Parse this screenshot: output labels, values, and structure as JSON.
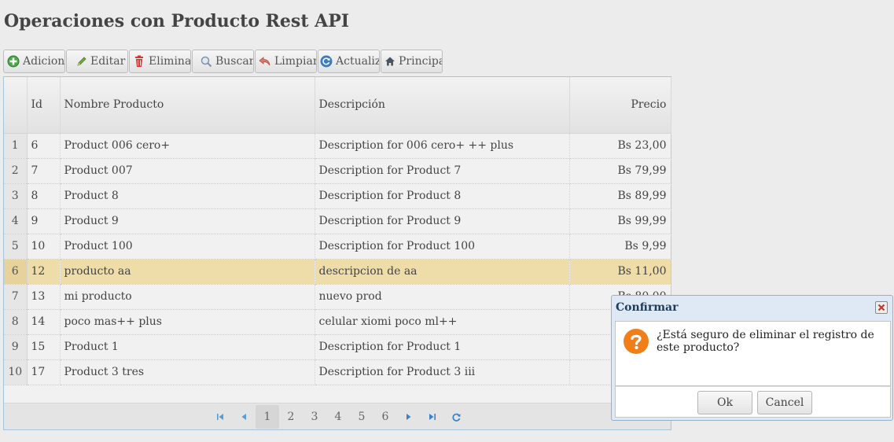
{
  "title": "Operaciones con Producto Rest API",
  "toolbar": {
    "buttons": [
      {
        "label": "Adicionar",
        "icon": "add-icon"
      },
      {
        "label": "Editar",
        "icon": "pencil-icon"
      },
      {
        "label": "Eliminar",
        "icon": "trash-icon"
      },
      {
        "label": "Buscar",
        "icon": "search-icon"
      },
      {
        "label": "Limpiar",
        "icon": "undo-icon"
      },
      {
        "label": "Actualizar",
        "icon": "refresh-icon"
      },
      {
        "label": "Principal",
        "icon": "home-icon"
      }
    ]
  },
  "grid": {
    "columns": {
      "id": "Id",
      "name": "Nombre Producto",
      "desc": "Descripción",
      "price": "Precio"
    },
    "rows": [
      {
        "n": "1",
        "id": "6",
        "name": "Product 006 cero+",
        "desc": "Description for 006 cero+ ++ plus",
        "price": "Bs 23,00"
      },
      {
        "n": "2",
        "id": "7",
        "name": "Product 007",
        "desc": "Description for Product 7",
        "price": "Bs 79,99"
      },
      {
        "n": "3",
        "id": "8",
        "name": "Product 8",
        "desc": "Description for Product 8",
        "price": "Bs 89,99"
      },
      {
        "n": "4",
        "id": "9",
        "name": "Product 9",
        "desc": "Description for Product 9",
        "price": "Bs 99,99"
      },
      {
        "n": "5",
        "id": "10",
        "name": "Product 100",
        "desc": "Description for Product 100",
        "price": "Bs 9,99"
      },
      {
        "n": "6",
        "id": "12",
        "name": "producto aa",
        "desc": "descripcion de aa",
        "price": "Bs 11,00"
      },
      {
        "n": "7",
        "id": "13",
        "name": "mi producto",
        "desc": "nuevo prod",
        "price": "Bs 80,00"
      },
      {
        "n": "8",
        "id": "14",
        "name": "poco mas++ plus",
        "desc": "celular xiomi poco ml++",
        "price": ""
      },
      {
        "n": "9",
        "id": "15",
        "name": "Product 1",
        "desc": "Description for Product 1",
        "price": ""
      },
      {
        "n": "10",
        "id": "17",
        "name": "Product 3 tres",
        "desc": "Description for Product 3 iii",
        "price": ""
      }
    ],
    "selected_row": "6"
  },
  "pager": {
    "pages": [
      "1",
      "2",
      "3",
      "4",
      "5",
      "6"
    ],
    "current": "1",
    "icons": [
      "first-page-icon",
      "prev-page-icon",
      "next-page-icon",
      "last-page-icon",
      "reload-icon"
    ]
  },
  "dialog": {
    "title": "Confirmar",
    "message": "¿Está seguro de eliminar el registro de este producto?",
    "ok_label": "Ok",
    "cancel_label": "Cancel"
  },
  "colors": {
    "selected_row": "#eedda8",
    "grid_border": "#a8c3dc",
    "question_icon": "#f07f1a",
    "dialog_title": "#1e3c5a"
  }
}
